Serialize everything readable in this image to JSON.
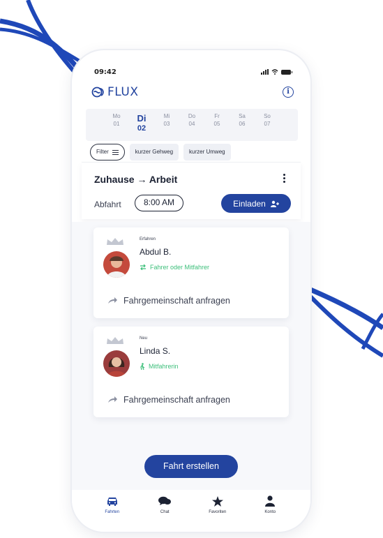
{
  "colors": {
    "brand": "#23449f",
    "accent_green": "#3cbf7a",
    "background_curve": "#1f48b8"
  },
  "status_bar": {
    "time": "09:42"
  },
  "app": {
    "logo_text": "FLUX",
    "info_icon": "info-icon"
  },
  "week": [
    {
      "name": "Mo",
      "date": "01",
      "active": false
    },
    {
      "name": "Di",
      "date": "02",
      "active": true
    },
    {
      "name": "Mi",
      "date": "03",
      "active": false
    },
    {
      "name": "Do",
      "date": "04",
      "active": false
    },
    {
      "name": "Fr",
      "date": "05",
      "active": false
    },
    {
      "name": "Sa",
      "date": "06",
      "active": false
    },
    {
      "name": "So",
      "date": "07",
      "active": false
    }
  ],
  "filters": {
    "filter_label": "Filter",
    "chip1": "kurzer Gehweg",
    "chip2": "kurzer Umweg"
  },
  "route": {
    "title": "Zuhause → Arbeit",
    "departure_label": "Abfahrt",
    "departure_time": "8:00 AM",
    "invite_label": "Einladen"
  },
  "matches": [
    {
      "level": "Erfahren",
      "name": "Abdul B.",
      "role": "Fahrer oder Mitfahrer",
      "role_icon": "car-swap-icon",
      "action": "Fahrgemeinschaft anfragen"
    },
    {
      "level": "Neu",
      "name": "Linda S.",
      "role": "Mitfahrerin",
      "role_icon": "walk-icon",
      "action": "Fahrgemeinschaft anfragen"
    }
  ],
  "create_button": "Fahrt erstellen",
  "tabs": [
    {
      "label": "Fahrten",
      "icon": "car-icon",
      "active": true
    },
    {
      "label": "Chat",
      "icon": "chat-icon",
      "active": false
    },
    {
      "label": "Favoriten",
      "icon": "star-icon",
      "active": false
    },
    {
      "label": "Konto",
      "icon": "user-icon",
      "active": false
    }
  ]
}
